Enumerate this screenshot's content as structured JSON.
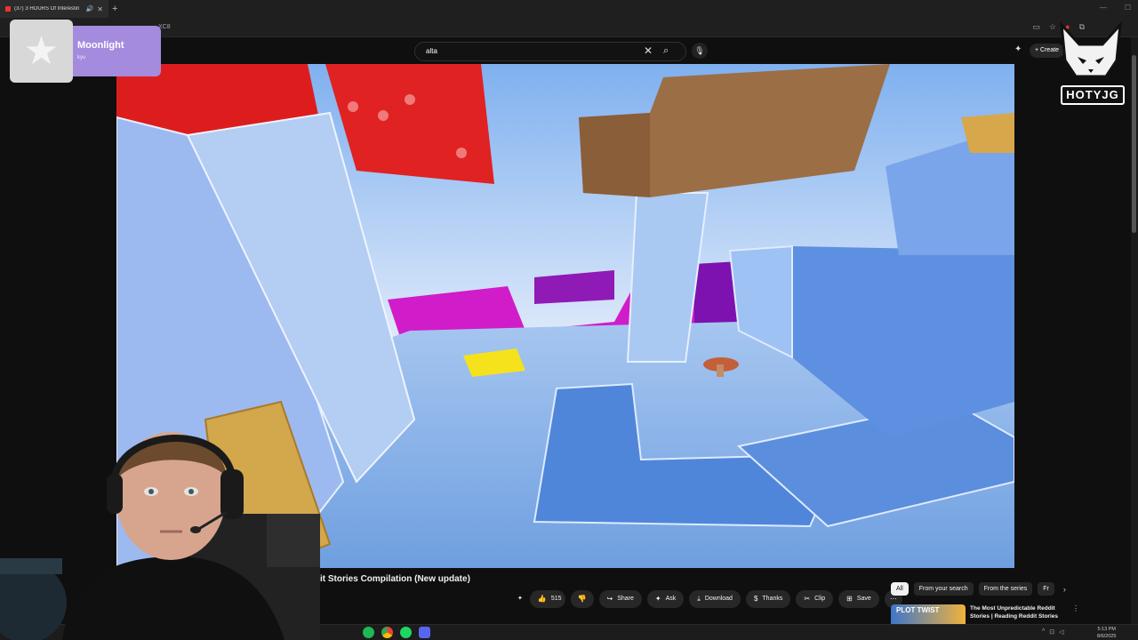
{
  "browser": {
    "tab_title": "(37) 3 HOURS Of Interestin",
    "new_tab": "+",
    "url_fragment": "XC8"
  },
  "youtube": {
    "search_query": "alta",
    "create_label": "Create",
    "video_title": "it Stories Compilation (New update)",
    "likes": "515",
    "actions": {
      "share": "Share",
      "ask": "Ask",
      "download": "Download",
      "thanks": "Thanks",
      "clip": "Clip",
      "save": "Save"
    },
    "chips": [
      "All",
      "From your search",
      "From the series",
      "Fr"
    ],
    "related": {
      "thumb_text": "PLOT TWIST",
      "title": "The Most Unpredictable Reddit Stories | Reading Reddit Stories"
    }
  },
  "overlay": {
    "now_playing_title": "Moonlight",
    "now_playing_artist": "kyu",
    "logo_text": "HOTYJG"
  },
  "taskbar": {
    "time": "5:13 PM",
    "date": "8/6/2025"
  },
  "icons": [
    "star-icon",
    "youtube-favicon",
    "speaker-icon",
    "close-icon",
    "search-icon",
    "mic-icon",
    "plus-icon",
    "like-icon",
    "dislike-icon",
    "share-icon",
    "sparkle-icon",
    "download-icon",
    "thanks-icon",
    "clip-icon",
    "save-icon",
    "more-icon",
    "chevron-right-icon"
  ],
  "colors": {
    "background": "#0f0f0f",
    "pill": "#272727",
    "notification": "#a58bde",
    "accent_red": "#ff0000"
  }
}
